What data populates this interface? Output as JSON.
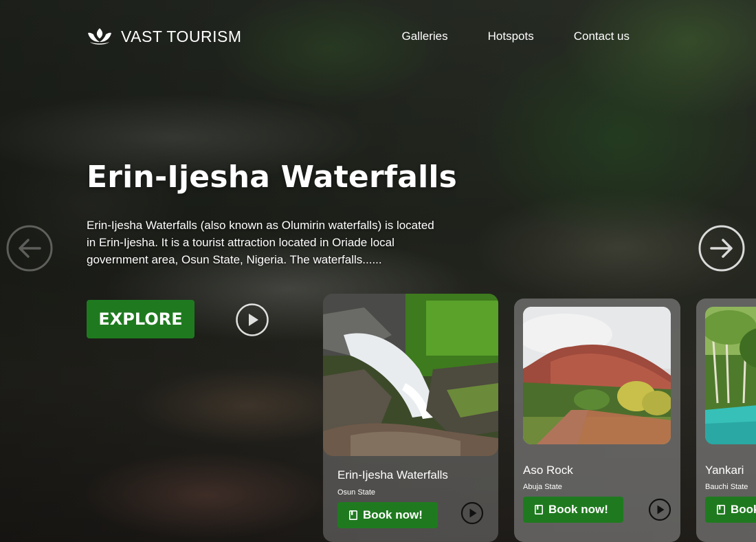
{
  "brand": {
    "name": "VAST TOURISM",
    "logo_icon": "lotus-icon"
  },
  "nav": {
    "links": [
      {
        "label": "Galleries"
      },
      {
        "label": "Hotspots"
      },
      {
        "label": "Contact us"
      }
    ]
  },
  "hero": {
    "title": "Erin-Ijesha Waterfalls",
    "description": "Erin-Ijesha Waterfalls (also known as Olumirin waterfalls) is located in Erin-Ijesha. It is a tourist attraction located in Oriade local government area, Osun State, Nigeria. The waterfalls......",
    "explore_label": "EXPLORE",
    "play_icon": "play-circle-icon"
  },
  "carousel": {
    "prev_icon": "arrow-left-circle-icon",
    "next_icon": "arrow-right-circle-icon",
    "cards": [
      {
        "title": "Erin-Ijesha Waterfalls",
        "location": "Osun State",
        "book_label": "Book now!",
        "book_icon": "bookmark-icon"
      },
      {
        "title": "Aso Rock",
        "location": "Abuja State",
        "book_label": "Book now!",
        "book_icon": "bookmark-icon"
      },
      {
        "title": "Yankari",
        "location": "Bauchi State",
        "book_label": "Book now!",
        "book_icon": "bookmark-icon"
      }
    ]
  },
  "colors": {
    "accent_green": "#1f7a1f",
    "card_glass": "rgba(150,150,150,0.55)",
    "text": "#ffffff"
  }
}
